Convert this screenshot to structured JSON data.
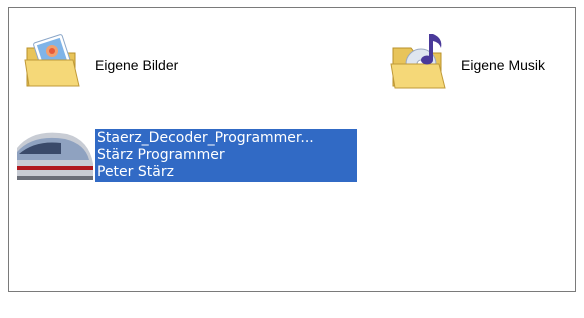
{
  "view": {
    "items": [
      {
        "title": "Eigene Bilder",
        "icon": "pictures-folder-icon"
      },
      {
        "title": "Eigene Musik",
        "icon": "music-folder-icon"
      },
      {
        "title": "Staerz_Decoder_Programmer...",
        "subtitle": "Stärz Programmer",
        "author": "Peter Stärz",
        "icon": "train-app-icon",
        "selected": true
      }
    ],
    "selection_color": "#316ac5"
  }
}
